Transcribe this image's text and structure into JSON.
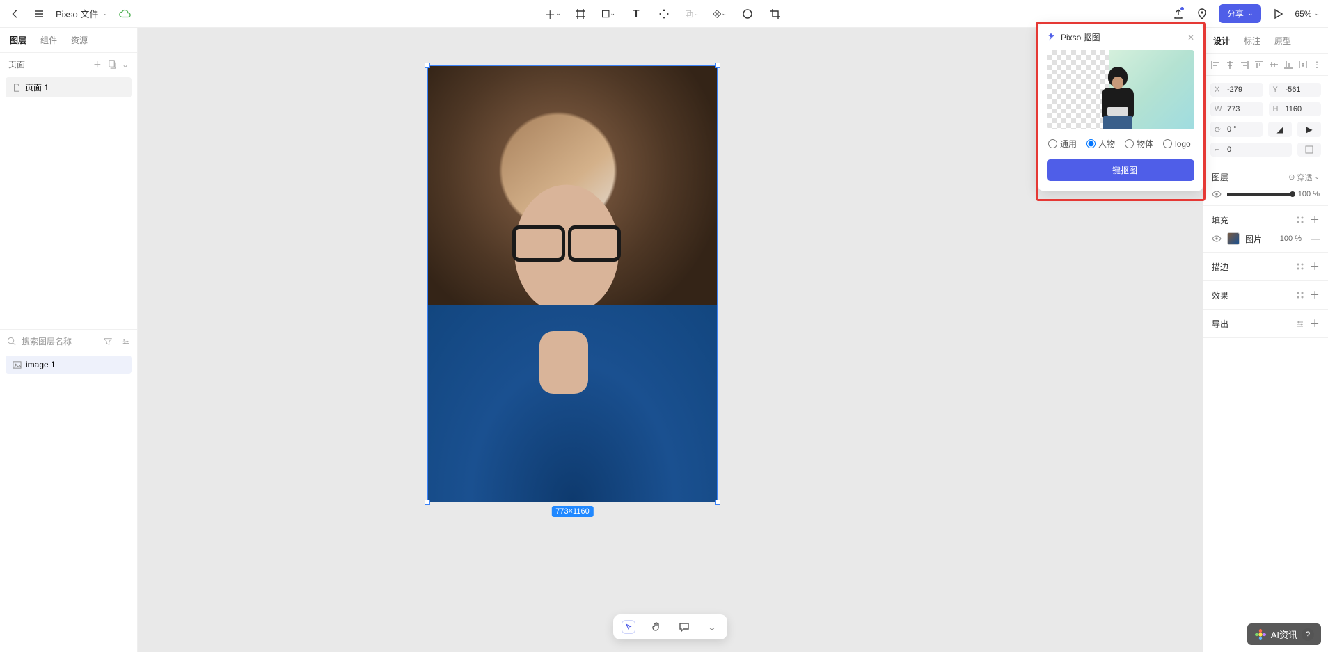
{
  "header": {
    "file_title": "Pixso 文件",
    "share": "分享",
    "zoom": "65%"
  },
  "left": {
    "tabs": {
      "layers": "图层",
      "components": "组件",
      "assets": "资源"
    },
    "pages_header": "页面",
    "pages": [
      {
        "name": "页面 1"
      }
    ],
    "search_placeholder": "搜索图层名称",
    "layers": [
      {
        "name": "image 1"
      }
    ]
  },
  "canvas": {
    "dimension_badge": "773×1160"
  },
  "matting": {
    "title": "Pixso 抠图",
    "options": {
      "general": "通用",
      "person": "人物",
      "object": "物体",
      "logo": "logo"
    },
    "selected": "person",
    "button": "一键抠图"
  },
  "right": {
    "tabs": {
      "design": "设计",
      "annotate": "标注",
      "prototype": "原型"
    },
    "x": "-279",
    "y": "-561",
    "w": "773",
    "h": "1160",
    "rotation": "0 °",
    "radius": "0",
    "layer_section": "图层",
    "pass_through": "穿透",
    "opacity": "100",
    "fill_section": "填充",
    "fill_label": "图片",
    "fill_opacity": "100",
    "stroke_section": "描边",
    "effects_section": "效果",
    "export_section": "导出"
  },
  "bottom": {
    "watermark": "AI资讯"
  }
}
